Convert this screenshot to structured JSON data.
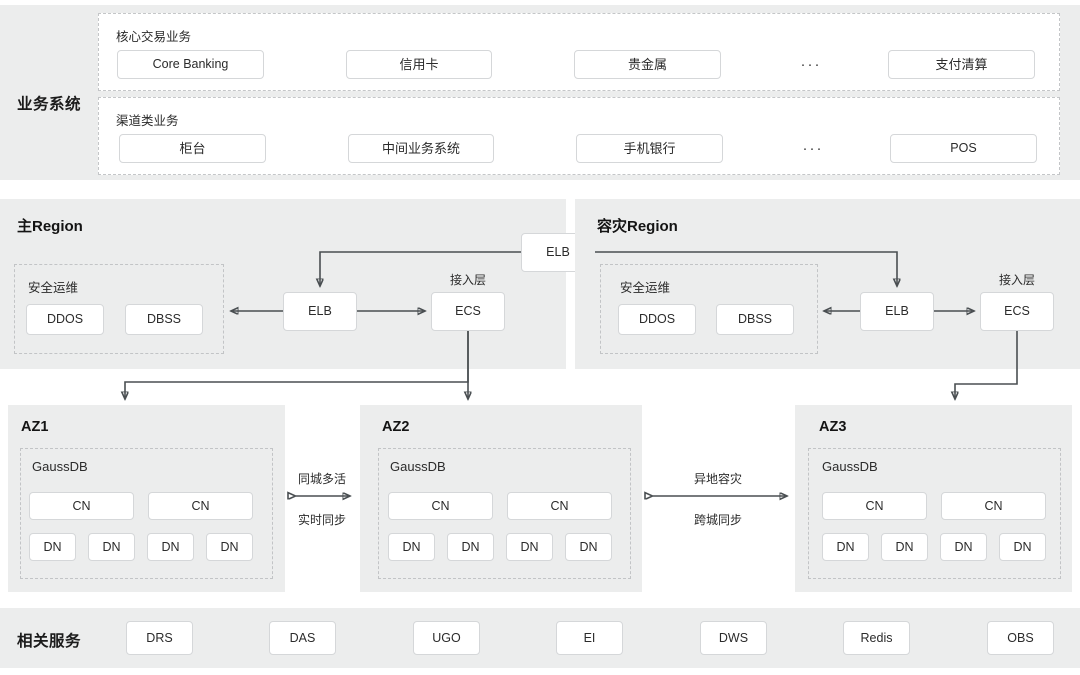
{
  "business": {
    "side_label": "业务系统",
    "rows": [
      {
        "title": "核心交易业务",
        "nodes": [
          "Core Banking",
          "信用卡",
          "贵金属",
          "支付清算"
        ],
        "ellipsis": "···"
      },
      {
        "title": "渠道类业务",
        "nodes": [
          "柜台",
          "中间业务系统",
          "手机银行",
          "POS"
        ],
        "ellipsis": "···"
      }
    ]
  },
  "center_elb": {
    "label": "ELB"
  },
  "regions": [
    {
      "title": "主Region",
      "security": {
        "title": "安全运维",
        "nodes": [
          "DDOS",
          "DBSS"
        ]
      },
      "elb": "ELB",
      "access_layer_label": "接入层",
      "ecs": "ECS"
    },
    {
      "title": "容灾Region",
      "security": {
        "title": "安全运维",
        "nodes": [
          "DDOS",
          "DBSS"
        ]
      },
      "elb": "ELB",
      "access_layer_label": "接入层",
      "ecs": "ECS"
    }
  ],
  "azs": [
    {
      "title": "AZ1",
      "db_title": "GaussDB",
      "cn_nodes": [
        "CN",
        "CN"
      ],
      "dn_nodes": [
        "DN",
        "DN",
        "DN",
        "DN"
      ]
    },
    {
      "title": "AZ2",
      "db_title": "GaussDB",
      "cn_nodes": [
        "CN",
        "CN"
      ],
      "dn_nodes": [
        "DN",
        "DN",
        "DN",
        "DN"
      ]
    },
    {
      "title": "AZ3",
      "db_title": "GaussDB",
      "cn_nodes": [
        "CN",
        "CN"
      ],
      "dn_nodes": [
        "DN",
        "DN",
        "DN",
        "DN"
      ]
    }
  ],
  "links": [
    {
      "top": "同城多活",
      "bottom": "实时同步"
    },
    {
      "top": "异地容灾",
      "bottom": "跨城同步"
    }
  ],
  "services": {
    "side_label": "相关服务",
    "nodes": [
      "DRS",
      "DAS",
      "UGO",
      "EI",
      "DWS",
      "Redis",
      "OBS"
    ]
  },
  "colors": {
    "panel_bg": "#eceded",
    "node_border": "#d5d7d9",
    "dashed_border": "#c4c6c8",
    "wire": "#4a4f52",
    "text": "#2b2b2b"
  }
}
